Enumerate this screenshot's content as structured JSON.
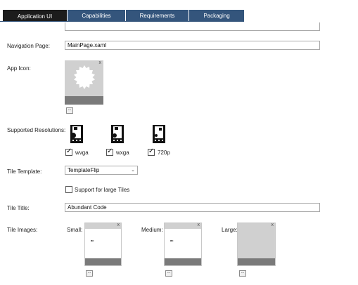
{
  "tabs": [
    "Application UI",
    "Capabilities",
    "Requirements",
    "Packaging"
  ],
  "navigation": {
    "label": "Navigation Page:",
    "value": "MainPage.xaml"
  },
  "app_icon": {
    "label": "App Icon:",
    "browse": "..."
  },
  "resolutions": {
    "label": "Supported Resolutions:",
    "items": [
      {
        "label": "wvga",
        "checked": true
      },
      {
        "label": "wxga",
        "checked": true
      },
      {
        "label": "720p",
        "checked": true
      }
    ]
  },
  "tile_template": {
    "label": "Tile Template:",
    "value": "TemplateFlip",
    "large_tiles_label": "Support for large Tiles",
    "large_tiles_checked": false
  },
  "tile_title": {
    "label": "Tile Title:",
    "value": "Abundant Code"
  },
  "tile_images": {
    "label": "Tile Images:",
    "small": {
      "label": "Small:",
      "logo": "ac"
    },
    "medium": {
      "label": "Medium:",
      "logo": "ac"
    },
    "large": {
      "label": "Large:"
    },
    "close_glyph": "x",
    "browse": "..."
  }
}
